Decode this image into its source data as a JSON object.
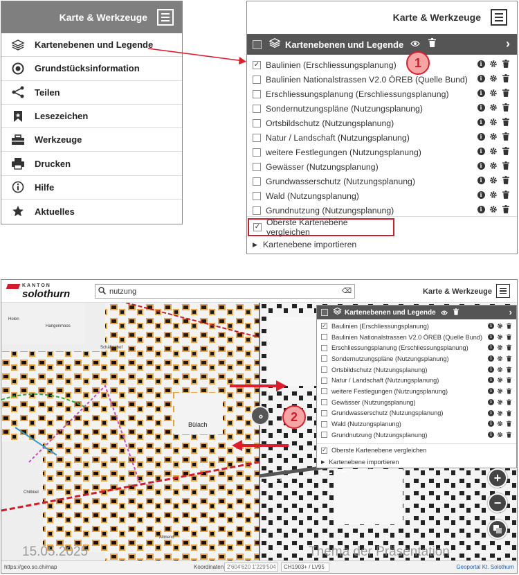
{
  "menu": {
    "title": "Karte & Werkzeuge",
    "items": [
      {
        "label": "Kartenebenen und Legende",
        "icon": "layers-icon"
      },
      {
        "label": "Grundstücksinformation",
        "icon": "target-icon"
      },
      {
        "label": "Teilen",
        "icon": "share-icon"
      },
      {
        "label": "Lesezeichen",
        "icon": "bookmark-icon"
      },
      {
        "label": "Werkzeuge",
        "icon": "toolbox-icon"
      },
      {
        "label": "Drucken",
        "icon": "printer-icon"
      },
      {
        "label": "Hilfe",
        "icon": "info-icon"
      },
      {
        "label": "Aktuelles",
        "icon": "star-icon"
      }
    ]
  },
  "layers_panel": {
    "title": "Karte & Werkzeuge",
    "bar_title": "Kartenebenen und Legende",
    "layers": [
      {
        "label": "Baulinien (Erschliessungsplanung)",
        "checked": true
      },
      {
        "label": "Baulinien Nationalstrassen V2.0 ÖREB (Quelle Bund)",
        "checked": false
      },
      {
        "label": "Erschliessungsplanung (Erschliessungsplanung)",
        "checked": false
      },
      {
        "label": "Sondernutzungspläne (Nutzungsplanung)",
        "checked": false
      },
      {
        "label": "Ortsbildschutz (Nutzungsplanung)",
        "checked": false
      },
      {
        "label": "Natur / Landschaft (Nutzungsplanung)",
        "checked": false
      },
      {
        "label": "weitere Festlegungen (Nutzungsplanung)",
        "checked": false
      },
      {
        "label": "Gewässer (Nutzungsplanung)",
        "checked": false
      },
      {
        "label": "Grundwasserschutz (Nutzungsplanung)",
        "checked": false
      },
      {
        "label": "Wald (Nutzungsplanung)",
        "checked": false
      },
      {
        "label": "Grundnutzung (Nutzungsplanung)",
        "checked": false
      }
    ],
    "compare_label": "Oberste Kartenebene vergleichen",
    "import_label": "Kartenebene importieren"
  },
  "badges": {
    "one": "1",
    "two": "2"
  },
  "map": {
    "logo_kanton": "KANTON",
    "logo_name": "solothurn",
    "search_value": "nutzung",
    "tools_title": "Karte & Werkzeuge",
    "coord_label": "Koordinaten:",
    "coord_value": "2'604'620 1'229'504",
    "crs": "CH1903+ / LV95",
    "url": "https://geo.so.ch/map",
    "portal": "Geoportal Kt. Solothurn",
    "zoom_in": "+",
    "zoom_out": "−",
    "swipe": "‹›",
    "labels": {
      "holen": "Holen",
      "hangenmoos": "Hangenmoos",
      "schaefershof": "Schäfershof",
      "chilbuel": "Chilbüel",
      "allmend": "Allmend",
      "bulach": "Bülach"
    }
  },
  "footer": {
    "date": "15.05.2025",
    "theme": "Thema der Präsentation"
  },
  "colors": {
    "accent_red": "#d11a2a",
    "dark_bar": "#555555",
    "menu_header": "#7f7f7f",
    "badge_fill": "#f6a5a5",
    "orange_building": "#e8a23c"
  }
}
